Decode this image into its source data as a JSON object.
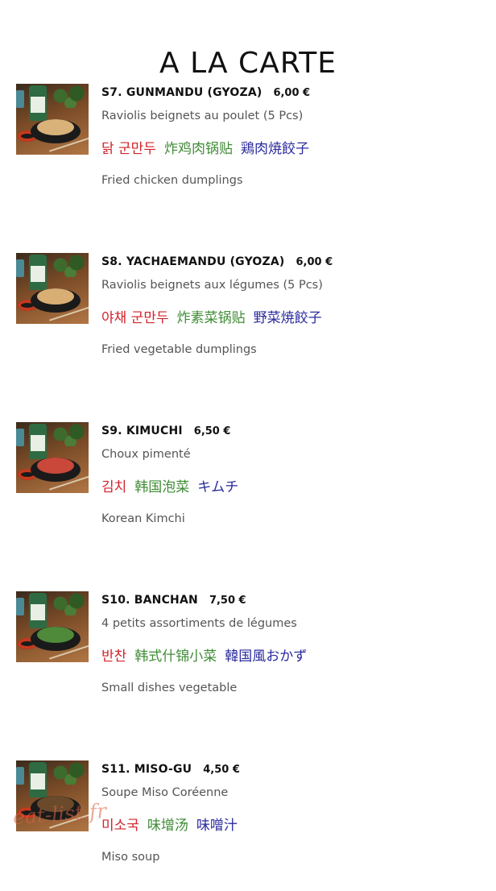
{
  "page": {
    "title": "A LA CARTE"
  },
  "items": [
    {
      "name": "S7. GUNMANDU (GYOZA)",
      "price": "6,00 €",
      "fr": "Raviolis beignets au poulet (5 Pcs)",
      "ko": "닭 군만두",
      "zh": "炸鸡肉锅贴",
      "ja": "鶏肉焼餃子",
      "en": "Fried chicken dumplings",
      "food_color": "#d9b27a"
    },
    {
      "name": "S8. YACHAEMANDU (GYOZA)",
      "price": "6,00 €",
      "fr": "Raviolis beignets aux légumes (5 Pcs)",
      "ko": "야채 군만두",
      "zh": "炸素菜锅贴",
      "ja": "野菜焼餃子",
      "en": "Fried vegetable dumplings",
      "food_color": "#d8ae74"
    },
    {
      "name": "S9. KIMUCHI",
      "price": "6,50 €",
      "fr": "Choux pimenté",
      "ko": "김치",
      "zh": "韩国泡菜",
      "ja": "キムチ",
      "en": "Korean Kimchi",
      "food_color": "#c9483a"
    },
    {
      "name": "S10. BANCHAN",
      "price": "7,50 €",
      "fr": "4 petits assortiments de légumes",
      "ko": "반찬",
      "zh": "韩式什锦小菜",
      "ja": "韓国風おかず",
      "en": "Small dishes vegetable",
      "food_color": "#4f8a3a"
    },
    {
      "name": "S11. MISO-GU",
      "price": "4,50 €",
      "fr": "Soupe Miso Coréenne",
      "ko": "미소국",
      "zh": "味增汤",
      "ja": "味噌汁",
      "en": "Miso soup",
      "food_color": "#6b4a2c"
    }
  ],
  "watermark": "eat-list.fr"
}
